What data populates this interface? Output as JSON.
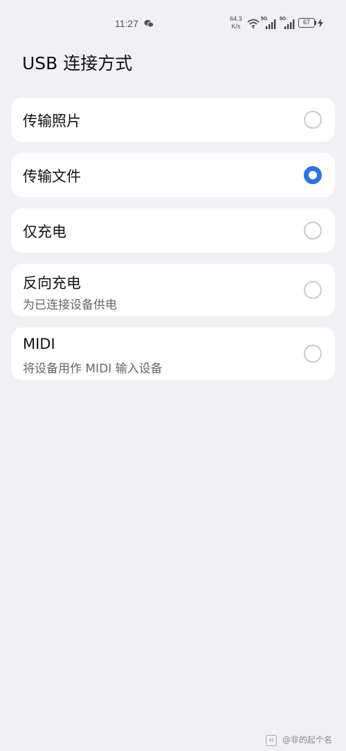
{
  "status_bar": {
    "time": "11:27",
    "net_speed_value": "64.3",
    "net_speed_unit": "K/s",
    "sim1_tag": "5G",
    "sim2_tag": "5G",
    "battery": "67",
    "icons": [
      "wechat-icon",
      "wifi-icon",
      "signal-icon",
      "signal-icon",
      "battery-icon",
      "charging-bolt-icon"
    ]
  },
  "page": {
    "title": "USB 连接方式"
  },
  "options": [
    {
      "label": "传输照片",
      "desc": "",
      "selected": false
    },
    {
      "label": "传输文件",
      "desc": "",
      "selected": true
    },
    {
      "label": "仅充电",
      "desc": "",
      "selected": false
    },
    {
      "label": "反向充电",
      "desc": "为已连接设备供电",
      "selected": false
    },
    {
      "label": "MIDI",
      "desc": "将设备用作 MIDI 输入设备",
      "selected": false
    }
  ],
  "colors": {
    "accent": "#2f6fe8",
    "background": "#f1f1f5",
    "card": "#ffffff"
  },
  "watermark": {
    "logo": "H",
    "text": "@非的起个名"
  }
}
